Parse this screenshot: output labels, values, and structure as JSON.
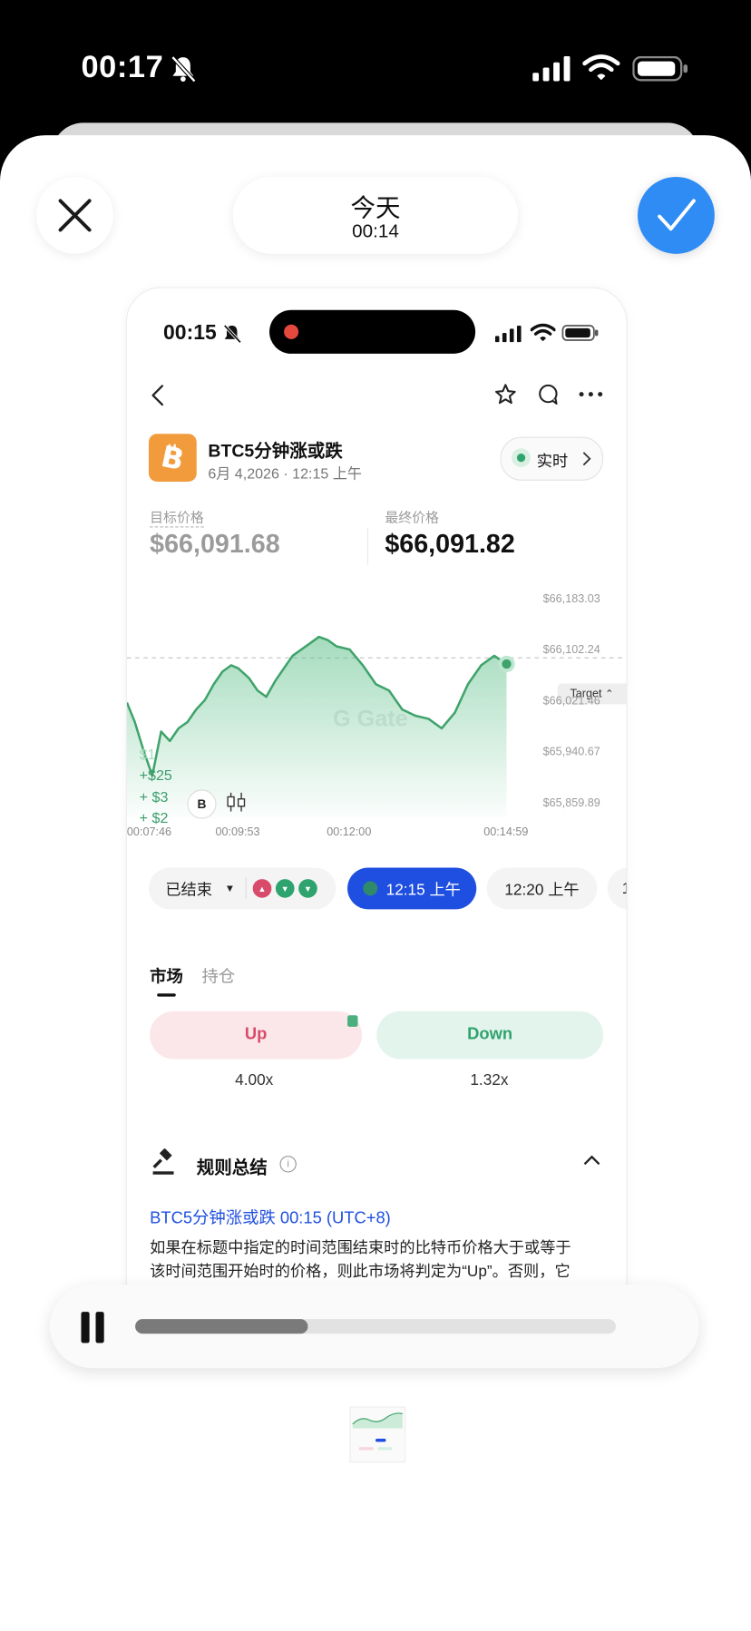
{
  "status_bar": {
    "time": "00:17"
  },
  "header": {
    "title": "今天",
    "subtitle": "00:14"
  },
  "inner_status": {
    "time": "00:15"
  },
  "market": {
    "title": "BTC5分钟涨或跌",
    "date": "6月 4,2026 · 12:15 上午",
    "live_label": "实时",
    "target_label": "目标价格",
    "target_value": "$66,091.68",
    "final_label": "最终价格",
    "final_value": "$66,091.82"
  },
  "chart_data": {
    "type": "area",
    "y_ticks": [
      "$66,183.03",
      "$66,102.24",
      "$66,021.46",
      "$65,940.67",
      "$65,859.89"
    ],
    "x_ticks": [
      "00:07:46",
      "00:09:53",
      "00:12:00",
      "00:14:59"
    ],
    "target_label": "Target",
    "target_value": 66091.68,
    "bet_labels": [
      "$1",
      "+$25",
      "+ $3",
      "+ $2"
    ],
    "series": [
      {
        "x": [
          "00:07:46",
          "00:07:55",
          "00:08:05",
          "00:08:15",
          "00:08:25",
          "00:08:35",
          "00:08:45",
          "00:08:55",
          "00:09:05",
          "00:09:15",
          "00:09:25",
          "00:09:35",
          "00:09:45",
          "00:09:53",
          "00:10:05",
          "00:10:15",
          "00:10:25",
          "00:10:35",
          "00:10:45",
          "00:10:55",
          "00:11:05",
          "00:11:15",
          "00:11:25",
          "00:11:35",
          "00:11:45",
          "00:12:00",
          "00:12:15",
          "00:12:30",
          "00:12:45",
          "00:13:00",
          "00:13:15",
          "00:13:30",
          "00:13:45",
          "00:14:00",
          "00:14:15",
          "00:14:30",
          "00:14:45",
          "00:14:59"
        ],
        "y": [
          66021,
          65990,
          65945,
          65905,
          65975,
          65960,
          65980,
          65990,
          66010,
          66025,
          66050,
          66070,
          66080,
          66075,
          66060,
          66040,
          66030,
          66055,
          66075,
          66095,
          66105,
          66115,
          66125,
          66120,
          66110,
          66105,
          66080,
          66050,
          66040,
          66010,
          66000,
          65995,
          65980,
          66005,
          66050,
          66080,
          66095,
          66082
        ]
      }
    ]
  },
  "rounds": {
    "status_label": "已结束",
    "round_active": "12:15 上午",
    "round_next": "12:20 上午",
    "round_more": "1"
  },
  "tabs": {
    "market": "市场",
    "position": "持仓"
  },
  "trade": {
    "up_label": "Up",
    "down_label": "Down",
    "up_multiplier": "4.00x",
    "down_multiplier": "1.32x"
  },
  "rules": {
    "heading": "规则总结",
    "subtitle": "BTC5分钟涨或跌 00:15 (UTC+8)",
    "line1": "如果在标题中指定的时间范围结束时的比特币价格大于或等于",
    "line2": "该时间范围开始时的价格，则此市场将判定为“Up”。否则，它"
  },
  "player": {
    "progress": 0.36
  },
  "colors": {
    "accent_blue": "#1f5ce4",
    "up_red": "#d94b6a",
    "down_green": "#2fa36e",
    "line_green": "#3fa36b"
  }
}
